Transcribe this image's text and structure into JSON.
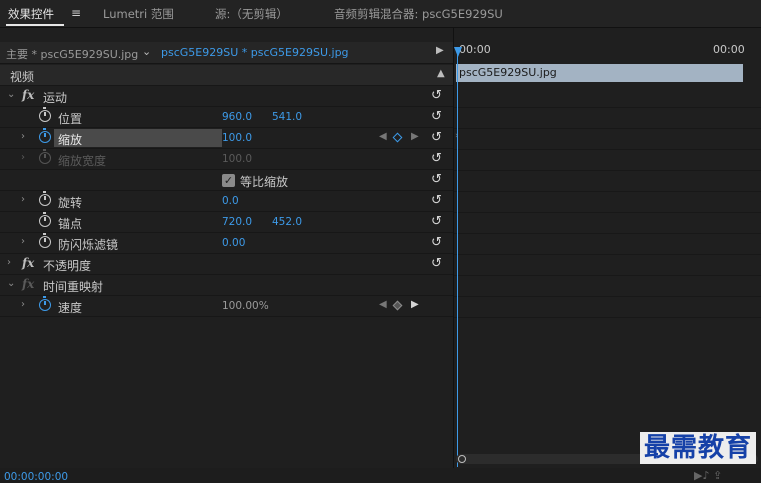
{
  "tabs": {
    "effect_controls": "效果控件",
    "lumetri": "Lumetri 范围",
    "source": "源:（无剪辑）",
    "audio_mixer": "音频剪辑混合器: pscG5E929SU"
  },
  "clip_bar": {
    "master": "主要 * pscG5E929SU.jpg",
    "sequence": "pscG5E929SU * pscG5E929SU.jpg"
  },
  "sections": {
    "video": "视频",
    "motion": "运动",
    "opacity": "不透明度",
    "time_remap": "时间重映射"
  },
  "properties": {
    "position": {
      "label": "位置",
      "x": "960.0",
      "y": "541.0"
    },
    "scale": {
      "label": "缩放",
      "value": "100.0"
    },
    "scale_width": {
      "label": "缩放宽度",
      "value": "100.0"
    },
    "uniform_scale": {
      "label": "等比缩放",
      "checked": true
    },
    "rotation": {
      "label": "旋转",
      "value": "0.0"
    },
    "anchor": {
      "label": "锚点",
      "x": "720.0",
      "y": "452.0"
    },
    "anti_flicker": {
      "label": "防闪烁滤镜",
      "value": "0.00"
    },
    "speed": {
      "label": "速度",
      "value": "100.00%"
    }
  },
  "timeline": {
    "ruler_start": "00:00",
    "ruler_end": "00:00",
    "clip_name": "pscG5E929SU.jpg"
  },
  "timecode": "00:00:00:00",
  "watermark": "最需教育",
  "colors": {
    "accent_blue": "#3d9ae8",
    "clip_track": "#a3b3c3",
    "watermark": "#1541a8"
  },
  "icons": [
    "menu-icon",
    "fx-icon",
    "stopwatch-icon",
    "reset-icon",
    "chevron-icon",
    "keyframe-diamond-icon",
    "play-icon"
  ]
}
